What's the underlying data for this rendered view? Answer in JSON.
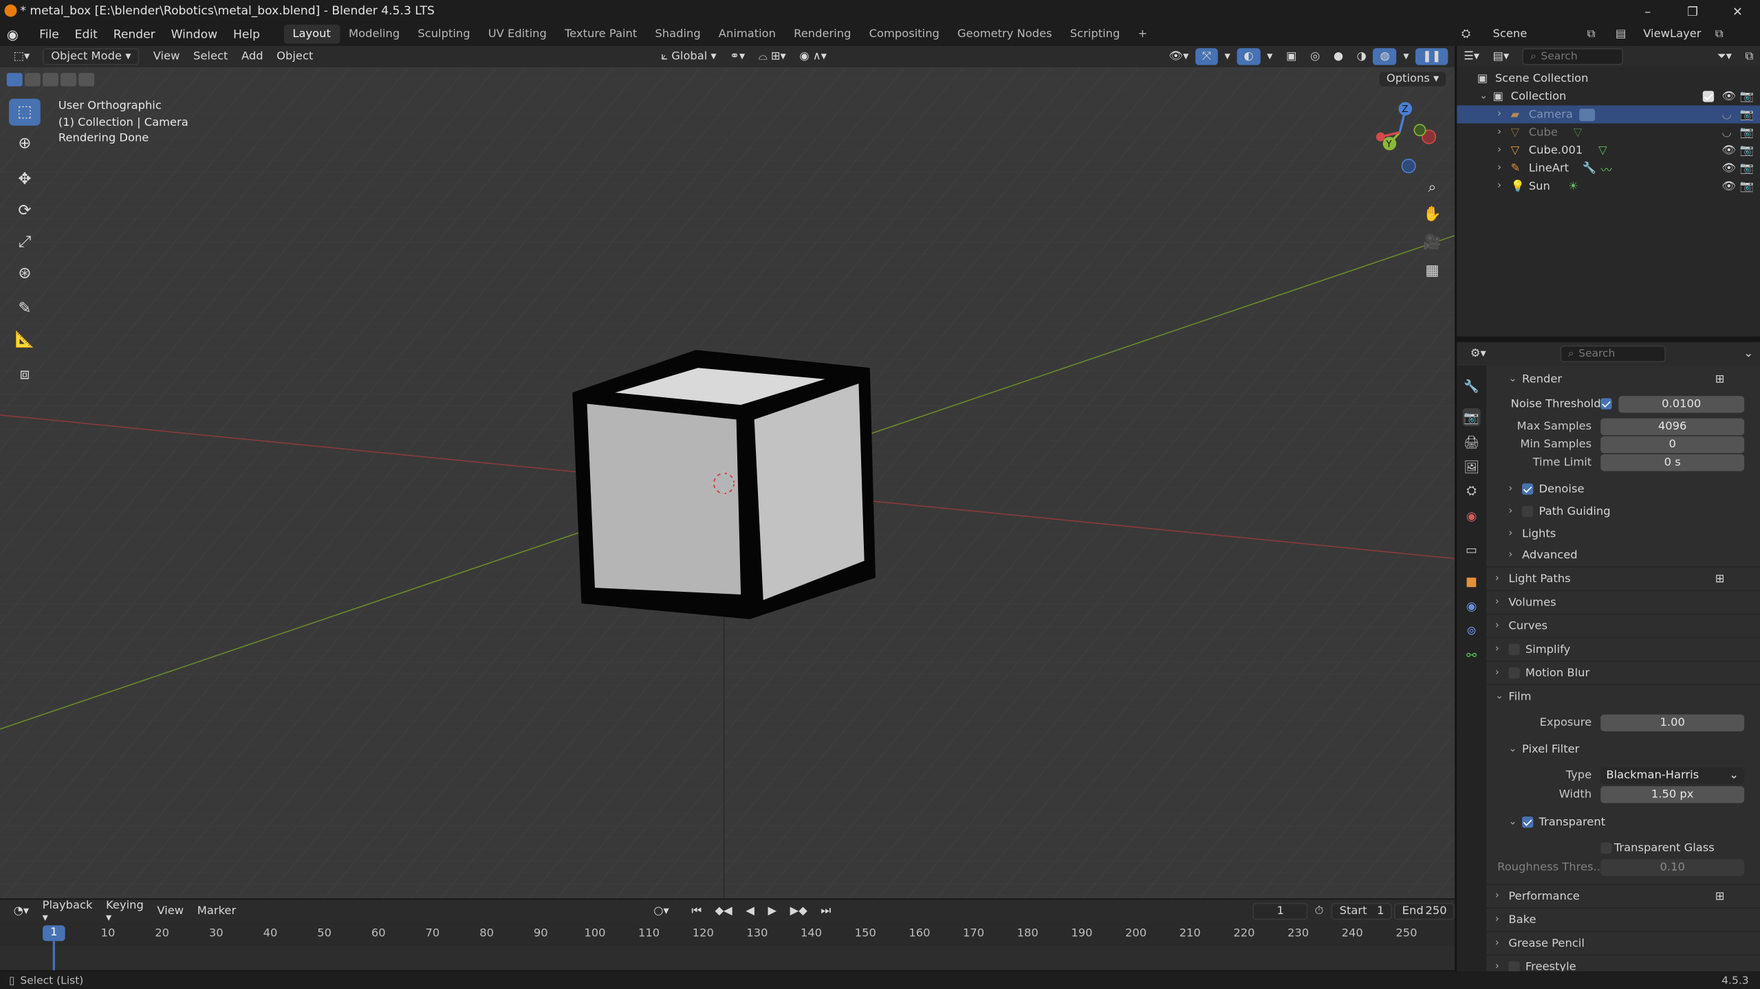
{
  "title": "* metal_box [E:\\blender\\Robotics\\metal_box.blend] - Blender 4.5.3 LTS",
  "menu": [
    "File",
    "Edit",
    "Render",
    "Window",
    "Help"
  ],
  "workspaces": [
    "Layout",
    "Modeling",
    "Sculpting",
    "UV Editing",
    "Texture Paint",
    "Shading",
    "Animation",
    "Rendering",
    "Compositing",
    "Geometry Nodes",
    "Scripting"
  ],
  "active_workspace": "Layout",
  "scene": "Scene",
  "view_layer": "ViewLayer",
  "viewport": {
    "mode": "Object Mode",
    "menus": [
      "View",
      "Select",
      "Add",
      "Object"
    ],
    "transform_orientation": "Global",
    "options_label": "Options",
    "info_lines": [
      "User Orthographic",
      "(1) Collection | Camera",
      "Rendering Done"
    ]
  },
  "outliner": {
    "search_placeholder": "Search",
    "root": "Scene Collection",
    "collection": "Collection",
    "items": [
      "Camera",
      "Cube",
      "Cube.001",
      "LineArt",
      "Sun"
    ]
  },
  "properties": {
    "search_placeholder": "Search",
    "render_label": "Render",
    "noise_threshold_label": "Noise Threshold",
    "noise_threshold": "0.0100",
    "max_samples_label": "Max Samples",
    "max_samples": "4096",
    "min_samples_label": "Min Samples",
    "min_samples": "0",
    "time_limit_label": "Time Limit",
    "time_limit": "0 s",
    "denoise": "Denoise",
    "path_guiding": "Path Guiding",
    "lights": "Lights",
    "advanced": "Advanced",
    "light_paths": "Light Paths",
    "volumes": "Volumes",
    "curves": "Curves",
    "simplify": "Simplify",
    "motion_blur": "Motion Blur",
    "film": "Film",
    "exposure_label": "Exposure",
    "exposure": "1.00",
    "pixel_filter": "Pixel Filter",
    "type_label": "Type",
    "type_value": "Blackman-Harris",
    "width_label": "Width",
    "width_value": "1.50 px",
    "transparent": "Transparent",
    "transparent_glass": "Transparent Glass",
    "roughness_label": "Roughness Thres...",
    "roughness_value": "0.10",
    "performance": "Performance",
    "bake": "Bake",
    "grease_pencil": "Grease Pencil",
    "freestyle": "Freestyle"
  },
  "timeline": {
    "menus": [
      "Playback",
      "Keying",
      "View",
      "Marker"
    ],
    "current_frame": "1",
    "start_label": "Start",
    "start": "1",
    "end_label": "End",
    "end": "250",
    "ticks": [
      "10",
      "20",
      "30",
      "40",
      "50",
      "60",
      "70",
      "80",
      "90",
      "100",
      "110",
      "120",
      "130",
      "140",
      "150",
      "160",
      "170",
      "180",
      "190",
      "200",
      "210",
      "220",
      "230",
      "240",
      "250"
    ]
  },
  "status": {
    "left": "Select (List)",
    "version": "4.5.3"
  }
}
